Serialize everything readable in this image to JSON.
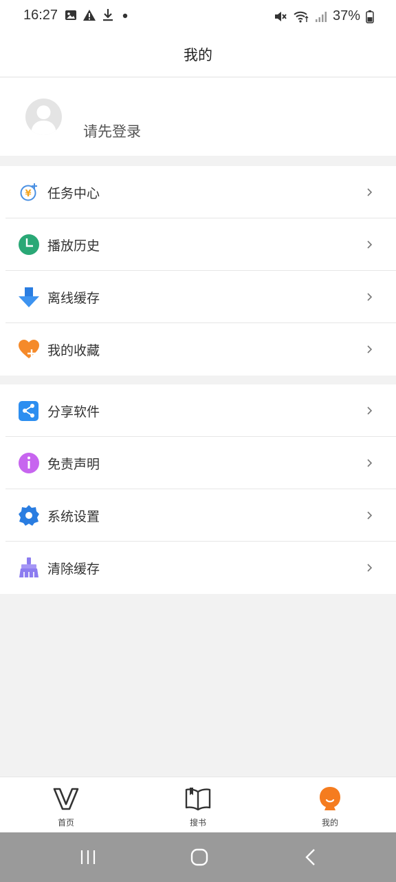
{
  "status_bar": {
    "time": "16:27",
    "battery_percent": "37%",
    "left_icons": [
      "image-icon",
      "warning-icon",
      "download-icon",
      "dot-icon"
    ],
    "right_icons": [
      "mute-icon",
      "wifi-icon",
      "signal-icon",
      "battery-icon"
    ]
  },
  "header": {
    "title": "我的"
  },
  "profile": {
    "login_prompt": "请先登录"
  },
  "menu_group_1": [
    {
      "label": "任务中心",
      "icon": "task-center-icon",
      "color": "#4a90e2"
    },
    {
      "label": "播放历史",
      "icon": "clock-icon",
      "color": "#2aa876"
    },
    {
      "label": "离线缓存",
      "icon": "download-arrow-icon",
      "color": "#2a7de1"
    },
    {
      "label": "我的收藏",
      "icon": "heart-plus-icon",
      "color": "#f58a2a"
    }
  ],
  "menu_group_2": [
    {
      "label": "分享软件",
      "icon": "share-icon",
      "color": "#2d8ef0"
    },
    {
      "label": "免责声明",
      "icon": "info-icon",
      "color": "#c765ef"
    },
    {
      "label": "系统设置",
      "icon": "gear-icon",
      "color": "#2a7de1"
    },
    {
      "label": "清除缓存",
      "icon": "broom-icon",
      "color": "#8c7cf0"
    }
  ],
  "tabbar": {
    "tabs": [
      {
        "label": "首页",
        "icon": "home-v-icon"
      },
      {
        "label": "搜书",
        "icon": "book-icon"
      },
      {
        "label": "我的",
        "icon": "profile-mascot-icon",
        "active": true
      }
    ],
    "active_color": "#f57c1f"
  },
  "system_nav": [
    "recents-button",
    "home-button",
    "back-button"
  ]
}
